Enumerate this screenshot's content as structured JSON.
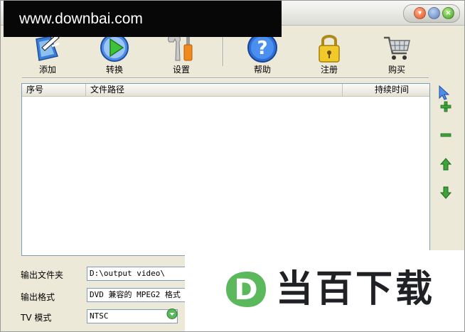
{
  "watermark": {
    "text": "www.downbai.com"
  },
  "toolbar": {
    "items": [
      {
        "label": "添加",
        "icon": "add-file-icon"
      },
      {
        "label": "转换",
        "icon": "convert-play-icon"
      },
      {
        "label": "设置",
        "icon": "settings-tools-icon"
      },
      {
        "label": "帮助",
        "icon": "help-question-icon"
      },
      {
        "label": "注册",
        "icon": "register-lock-icon"
      },
      {
        "label": "购买",
        "icon": "buy-cart-icon"
      }
    ]
  },
  "file_list": {
    "columns": [
      "序号",
      "文件路径",
      "持续时间"
    ],
    "rows": []
  },
  "side_buttons": [
    "pointer-icon",
    "add-icon",
    "remove-icon",
    "move-up-icon",
    "move-down-icon"
  ],
  "output": {
    "folder_label": "输出文件夹",
    "folder_value": "D:\\output video\\",
    "format_label": "输出格式",
    "format_value": "DVD 兼容的 MPEG2 格式",
    "tv_label": "TV 模式",
    "tv_value": "NTSC"
  },
  "logo_overlay": {
    "letter": "D",
    "text": "当百下载"
  },
  "colors": {
    "accent_green": "#5cb85c",
    "window_bg": "#ece9d8"
  }
}
